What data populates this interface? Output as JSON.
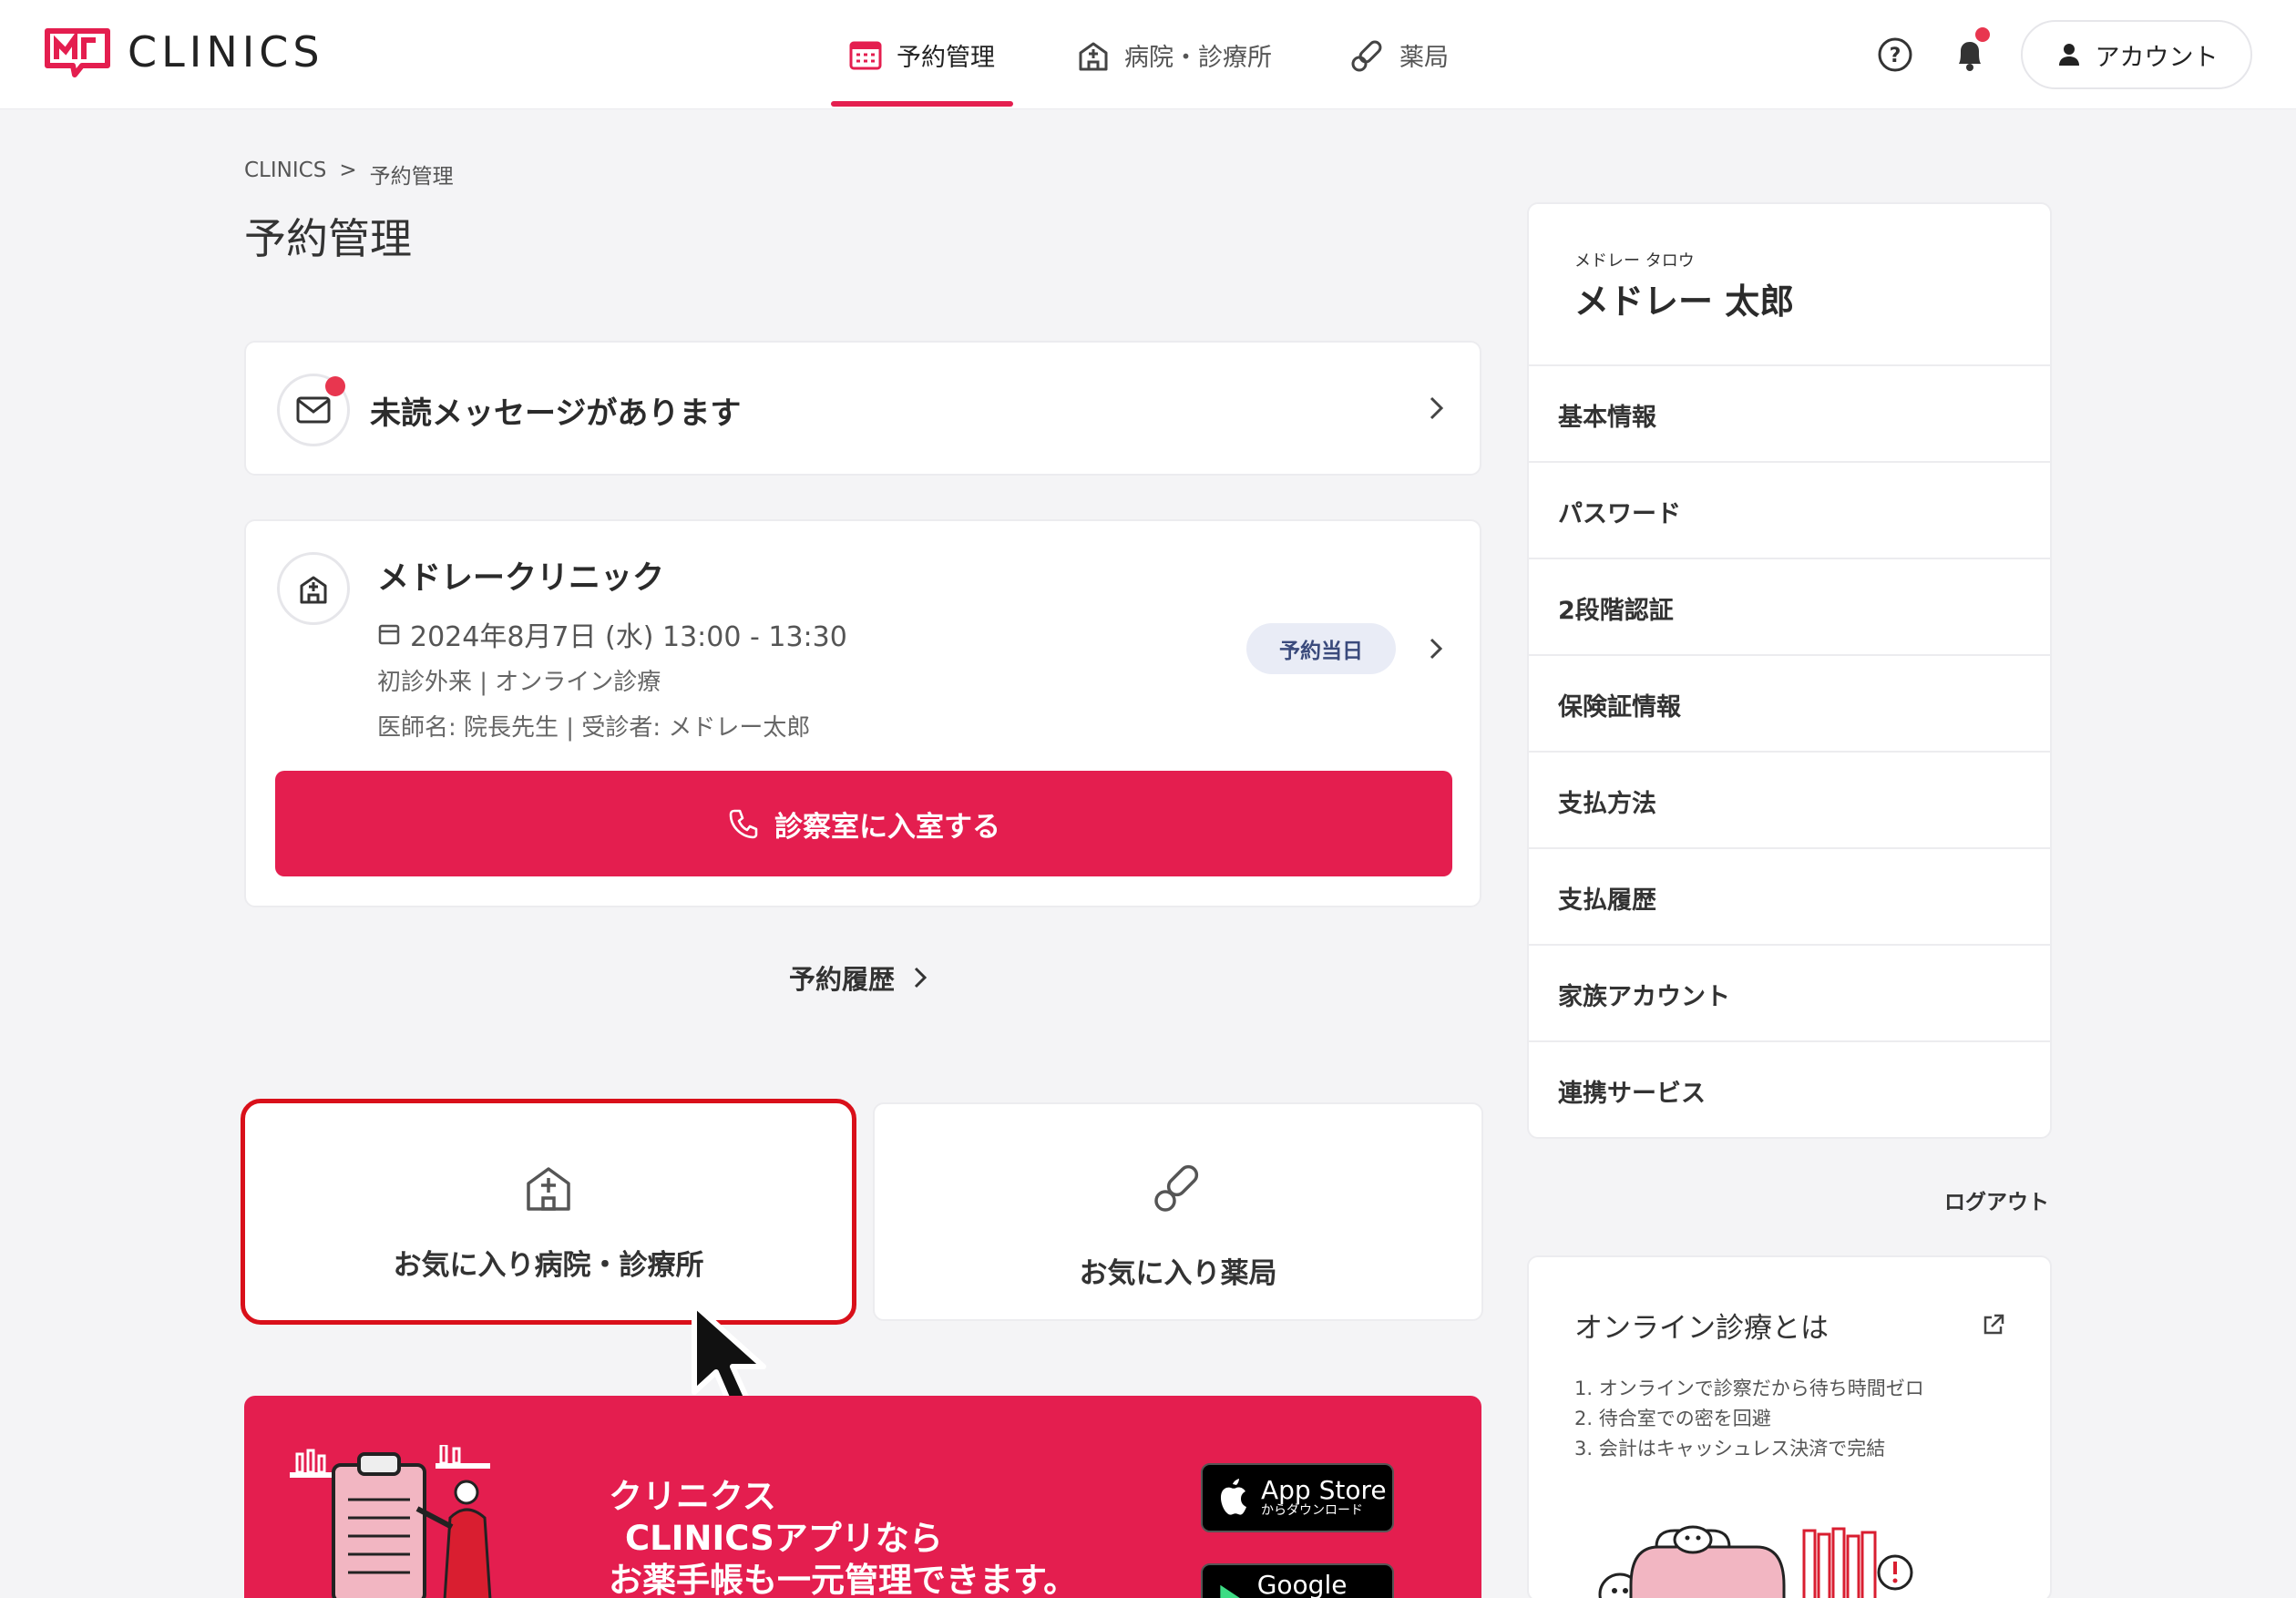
{
  "header": {
    "logo_text": "CLINICS",
    "nav": [
      {
        "label": "予約管理",
        "icon": "calendar-icon",
        "active": true
      },
      {
        "label": "病院・診療所",
        "icon": "hospital-icon",
        "active": false
      },
      {
        "label": "薬局",
        "icon": "pill-icon",
        "active": false
      }
    ],
    "account_label": "アカウント"
  },
  "breadcrumb": {
    "root": "CLINICS",
    "separator": ">",
    "current": "予約管理"
  },
  "page_title": "予約管理",
  "message_card": {
    "text": "未読メッセージがあります",
    "unread": true
  },
  "appointment": {
    "clinic_name": "メドレークリニック",
    "datetime": "2024年8月7日 (水) 13:00 - 13:30",
    "type": "初診外来 | オンライン診療",
    "doctor_patient": "医師名: 院長先生 | 受診者: メドレー太郎",
    "badge": "予約当日",
    "enter_button": "診察室に入室する"
  },
  "history_link": "予約履歴",
  "favorites": {
    "hospitals": "お気に入り病院・診療所",
    "pharmacies": "お気に入り薬局"
  },
  "banner": {
    "line1": "クリニクス",
    "line2": "CLINICSアプリなら",
    "line3": "お薬手帳も一元管理できます。",
    "app_store_main": "App Store",
    "app_store_sub": "からダウンロード",
    "google_play_main": "Google Play"
  },
  "sidebar": {
    "name_kana": "メドレー タロウ",
    "name": "メドレー 太郎",
    "items": [
      "基本情報",
      "パスワード",
      "2段階認証",
      "保険証情報",
      "支払方法",
      "支払履歴",
      "家族アカウント",
      "連携サービス"
    ],
    "logout": "ログアウト"
  },
  "online_info": {
    "title": "オンライン診療とは",
    "points": [
      "1. オンラインで診察だから待ち時間ゼロ",
      "2. 待合室での密を回避",
      "3. 会計はキャッシュレス決済で完結"
    ]
  },
  "colors": {
    "accent": "#e41e4f",
    "highlight": "#d9101a",
    "badge_bg": "#e9ecf6"
  }
}
